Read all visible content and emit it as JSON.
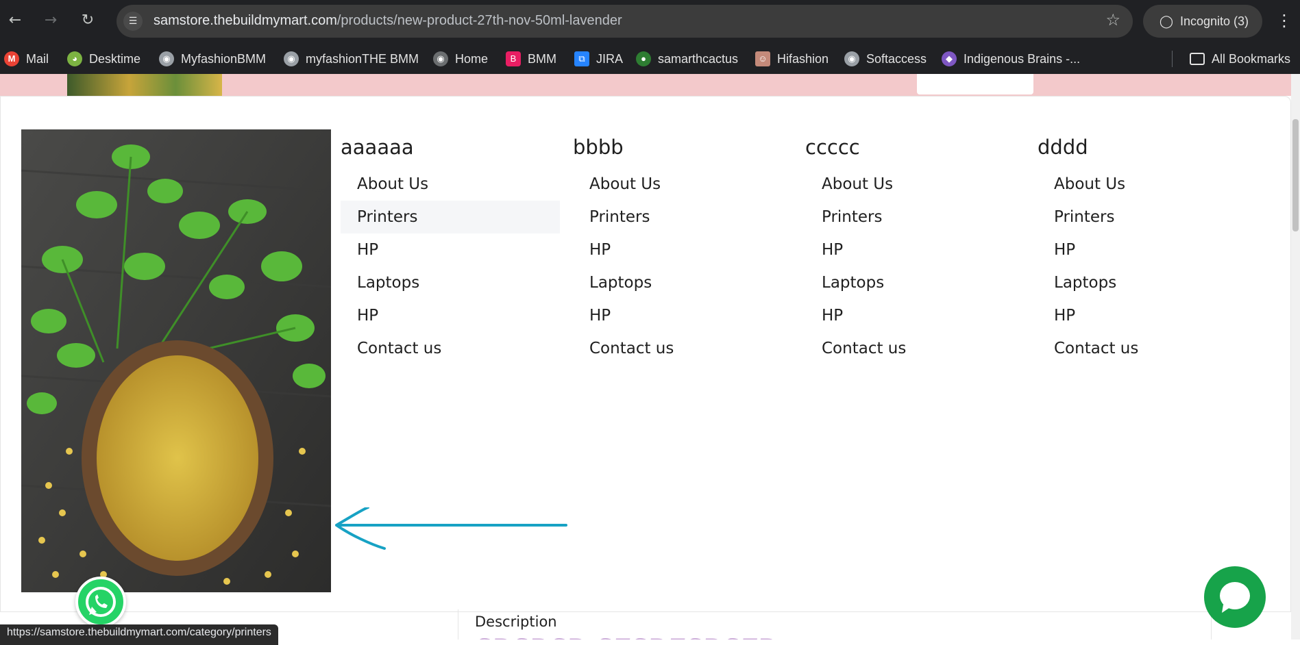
{
  "browser": {
    "url_host": "samstore.thebuildmymart.com",
    "url_path": "/products/new-product-27th-nov-50ml-lavender",
    "incognito_label": "Incognito (3)",
    "icons": {
      "back": "arrow-left-icon",
      "forward": "arrow-right-icon",
      "reload": "reload-icon",
      "site_info": "tune-icon",
      "bookmark_star": "star-icon",
      "incognito": "incognito-icon",
      "menu": "more-vert-icon"
    }
  },
  "bookmarks": {
    "items": [
      {
        "label": "Mail",
        "icon": "gmail-icon",
        "color": "#ea4335"
      },
      {
        "label": "Desktime",
        "icon": "desktime-icon",
        "color": "#7cb342"
      },
      {
        "label": "MyfashionBMM",
        "icon": "globe-icon",
        "color": "#9aa0a6"
      },
      {
        "label": "myfashionTHE BMM",
        "icon": "globe-icon",
        "color": "#9aa0a6"
      },
      {
        "label": "Home",
        "icon": "globe-icon",
        "color": "#6b6e70"
      },
      {
        "label": "BMM",
        "icon": "bmm-icon",
        "color": "#e91e63"
      },
      {
        "label": "JIRA",
        "icon": "jira-icon",
        "color": "#2684ff"
      },
      {
        "label": "samarthcactus",
        "icon": "cactus-icon",
        "color": "#2e7d32"
      },
      {
        "label": "Hifashion",
        "icon": "hifashion-icon",
        "color": "#c48a7a"
      },
      {
        "label": "Softaccess",
        "icon": "globe-icon",
        "color": "#9aa0a6"
      },
      {
        "label": "Indigenous Brains -...",
        "icon": "indigenous-icon",
        "color": "#7e57c2"
      }
    ],
    "all_bookmarks_label": "All Bookmarks"
  },
  "menu": {
    "columns": [
      {
        "heading": "aaaaaa",
        "items": [
          "About Us",
          "Printers",
          "HP",
          "Laptops",
          "HP",
          "Contact us"
        ]
      },
      {
        "heading": "bbbb",
        "items": [
          "About Us",
          "Printers",
          "HP",
          "Laptops",
          "HP",
          "Contact us"
        ]
      },
      {
        "heading": "ccccc",
        "items": [
          "About Us",
          "Printers",
          "HP",
          "Laptops",
          "HP",
          "Contact us"
        ]
      },
      {
        "heading": "dddd",
        "items": [
          "About Us",
          "Printers",
          "HP",
          "Laptops",
          "HP",
          "Contact us"
        ]
      }
    ],
    "active_item": "Printers"
  },
  "product": {
    "description_label": "Description",
    "description_text": "SDSDSD SFSDFSDSFD"
  },
  "status_bar": {
    "hover_url": "https://samstore.thebuildmymart.com/category/printers"
  },
  "widgets": {
    "whatsapp": "whatsapp-icon",
    "chat": "chat-bubble-icon"
  },
  "colors": {
    "accent_arrow": "#17a2c4",
    "pink_header": "#f3c9cb",
    "chat_green": "#17a34a",
    "whatsapp_green": "#25d366"
  }
}
